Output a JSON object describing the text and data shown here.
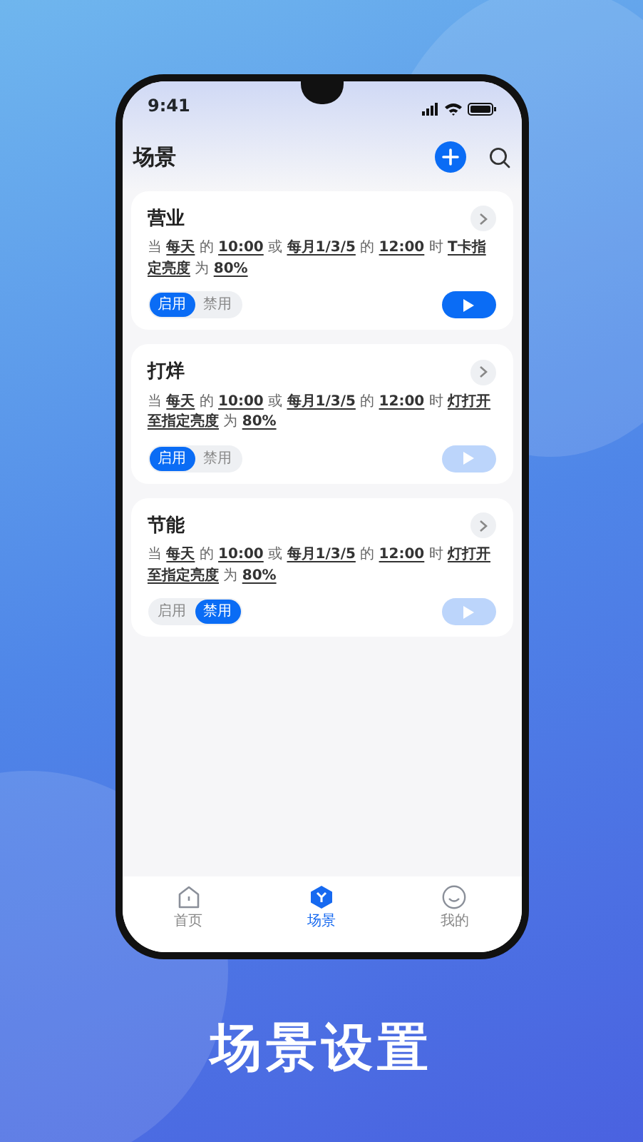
{
  "status_bar": {
    "time": "9:41"
  },
  "header": {
    "title": "场景"
  },
  "scenes": [
    {
      "title": "营业",
      "condition": "当 **每天** 的 **10:00** 或 **每月1/3/5** 的 **12:00** 时 **T卡指定亮度** 为 **80%**",
      "toggle": [
        {
          "label": "启用",
          "selected": true
        },
        {
          "label": "禁用",
          "selected": false
        }
      ],
      "play_disabled": false
    },
    {
      "title": "打烊",
      "condition": "当 **每天** 的 **10:00** 或 **每月1/3/5** 的 **12:00** 时 **灯打开至指定亮度** 为 **80%**",
      "toggle": [
        {
          "label": "启用",
          "selected": true
        },
        {
          "label": "禁用",
          "selected": false
        }
      ],
      "play_disabled": true
    },
    {
      "title": "节能",
      "condition": "当 **每天** 的 **10:00** 或 **每月1/3/5** 的 **12:00** 时 **灯打开至指定亮度** 为 **80%**",
      "toggle": [
        {
          "label": "启用",
          "selected": false
        },
        {
          "label": "禁用",
          "selected": true
        }
      ],
      "play_disabled": true
    }
  ],
  "tab_bar": [
    {
      "kind": "home",
      "label": "首页",
      "selected": false
    },
    {
      "kind": "scene",
      "label": "场景",
      "selected": true
    },
    {
      "kind": "profile",
      "label": "我的",
      "selected": false
    }
  ],
  "caption": "场景设置"
}
